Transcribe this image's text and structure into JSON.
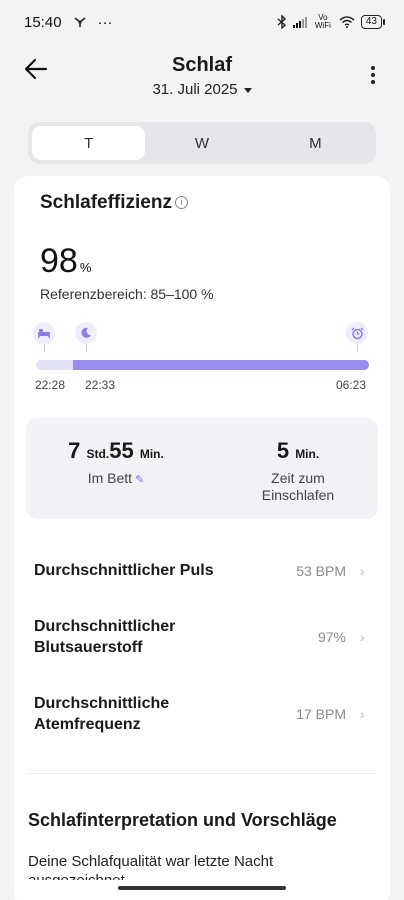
{
  "status": {
    "time": "15:40",
    "extra": "···",
    "volte": "Vo WiFi",
    "battery": "43"
  },
  "header": {
    "title": "Schlaf",
    "date": "31. Juli 2025"
  },
  "tabs": [
    {
      "label": "T",
      "active": true
    },
    {
      "label": "W",
      "active": false
    },
    {
      "label": "M",
      "active": false
    }
  ],
  "efficiency": {
    "title": "Schlafeffizienz",
    "value": "98",
    "unit": "%",
    "reference": "Referenzbereich: 85–100 %"
  },
  "timeline": {
    "bed_time": "22:28",
    "sleep_time": "22:33",
    "wake_time": "06:23",
    "awake_fraction": 0.011
  },
  "stats": {
    "in_bed": {
      "hours": "7",
      "hours_unit": "Std.",
      "minutes": "55",
      "minutes_unit": "Min.",
      "label": "Im Bett"
    },
    "fall_asleep": {
      "value": "5",
      "unit": "Min.",
      "label_line1": "Zeit zum",
      "label_line2": "Einschlafen"
    }
  },
  "metrics": [
    {
      "label_line1": "Durchschnittlicher Puls",
      "label_line2": "",
      "value": "53 BPM"
    },
    {
      "label_line1": "Durchschnittlicher",
      "label_line2": "Blutsauerstoff",
      "value": "97%"
    },
    {
      "label_line1": "Durchschnittliche",
      "label_line2": "Atemfrequenz",
      "value": "17 BPM"
    }
  ],
  "interpretation": {
    "title": "Schlafinterpretation und Vorschläge",
    "text": "Deine Schlafqualität war letzte Nacht ausgezeichnet."
  },
  "icons": {
    "back": "arrow-left-icon",
    "more": "more-vertical-icon",
    "info": "info-icon",
    "bed": "bed-icon",
    "moon": "moon-icon",
    "alarm": "alarm-clock-icon",
    "edit": "pencil-icon",
    "chevron": "chevron-right-icon"
  },
  "colors": {
    "accent": "#9b8df0",
    "track": "#e3e1f6"
  }
}
